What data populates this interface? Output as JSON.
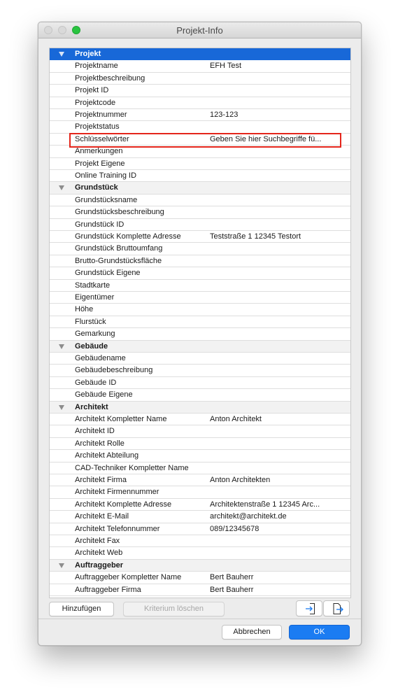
{
  "window": {
    "title": "Projekt-Info"
  },
  "rows": [
    {
      "type": "section",
      "label": "Projekt",
      "selected": true
    },
    {
      "type": "item",
      "name": "Projektname",
      "value": "EFH Test"
    },
    {
      "type": "item",
      "name": "Projektbeschreibung",
      "value": ""
    },
    {
      "type": "item",
      "name": "Projekt ID",
      "value": ""
    },
    {
      "type": "item",
      "name": "Projektcode",
      "value": ""
    },
    {
      "type": "item",
      "name": "Projektnummer",
      "value": "123-123"
    },
    {
      "type": "item",
      "name": "Projektstatus",
      "value": ""
    },
    {
      "type": "item",
      "name": "Schlüsselwörter",
      "value": "Geben Sie hier Suchbegriffe fü...",
      "highlighted": true
    },
    {
      "type": "item",
      "name": "Anmerkungen",
      "value": ""
    },
    {
      "type": "item",
      "name": "Projekt Eigene",
      "value": ""
    },
    {
      "type": "item",
      "name": "Online Training ID",
      "value": ""
    },
    {
      "type": "section",
      "label": "Grundstück"
    },
    {
      "type": "item",
      "name": "Grundstücksname",
      "value": ""
    },
    {
      "type": "item",
      "name": "Grundstücksbeschreibung",
      "value": ""
    },
    {
      "type": "item",
      "name": "Grundstück ID",
      "value": ""
    },
    {
      "type": "item",
      "name": "Grundstück Komplette Adresse",
      "value": "Teststraße 1 12345 Testort"
    },
    {
      "type": "item",
      "name": "Grundstück Bruttoumfang",
      "value": ""
    },
    {
      "type": "item",
      "name": "Brutto-Grundstücksfläche",
      "value": ""
    },
    {
      "type": "item",
      "name": "Grundstück Eigene",
      "value": ""
    },
    {
      "type": "item",
      "name": "Stadtkarte",
      "value": ""
    },
    {
      "type": "item",
      "name": "Eigentümer",
      "value": ""
    },
    {
      "type": "item",
      "name": "Höhe",
      "value": ""
    },
    {
      "type": "item",
      "name": "Flurstück",
      "value": ""
    },
    {
      "type": "item",
      "name": "Gemarkung",
      "value": ""
    },
    {
      "type": "section",
      "label": "Gebäude"
    },
    {
      "type": "item",
      "name": "Gebäudename",
      "value": ""
    },
    {
      "type": "item",
      "name": "Gebäudebeschreibung",
      "value": ""
    },
    {
      "type": "item",
      "name": "Gebäude ID",
      "value": ""
    },
    {
      "type": "item",
      "name": "Gebäude Eigene",
      "value": ""
    },
    {
      "type": "section",
      "label": "Architekt"
    },
    {
      "type": "item",
      "name": "Architekt Kompletter Name",
      "value": "Anton Architekt"
    },
    {
      "type": "item",
      "name": "Architekt ID",
      "value": ""
    },
    {
      "type": "item",
      "name": "Architekt Rolle",
      "value": ""
    },
    {
      "type": "item",
      "name": "Architekt Abteilung",
      "value": ""
    },
    {
      "type": "item",
      "name": "CAD-Techniker Kompletter Name",
      "value": ""
    },
    {
      "type": "item",
      "name": "Architekt Firma",
      "value": "Anton Architekten"
    },
    {
      "type": "item",
      "name": "Architekt Firmennummer",
      "value": ""
    },
    {
      "type": "item",
      "name": "Architekt Komplette Adresse",
      "value": "Architektenstraße 1 12345 Arc..."
    },
    {
      "type": "item",
      "name": "Architekt E-Mail",
      "value": "architekt@architekt.de"
    },
    {
      "type": "item",
      "name": "Architekt Telefonnummer",
      "value": "089/12345678"
    },
    {
      "type": "item",
      "name": "Architekt Fax",
      "value": ""
    },
    {
      "type": "item",
      "name": "Architekt Web",
      "value": ""
    },
    {
      "type": "section",
      "label": "Auftraggeber"
    },
    {
      "type": "item",
      "name": "Auftraggeber Kompletter Name",
      "value": "Bert Bauherr"
    },
    {
      "type": "item",
      "name": "Auftraggeber Firma",
      "value": "Bert Bauherr"
    }
  ],
  "toolbar": {
    "add_label": "Hinzufügen",
    "delete_label": "Kriterium löschen",
    "import_icon": "import-icon",
    "export_icon": "export-icon"
  },
  "footer": {
    "cancel_label": "Abbrechen",
    "ok_label": "OK"
  },
  "colors": {
    "selection": "#1868d8",
    "highlight_frame": "#e4251b",
    "primary_button": "#1b7cf2",
    "zoom_button": "#29c440"
  }
}
